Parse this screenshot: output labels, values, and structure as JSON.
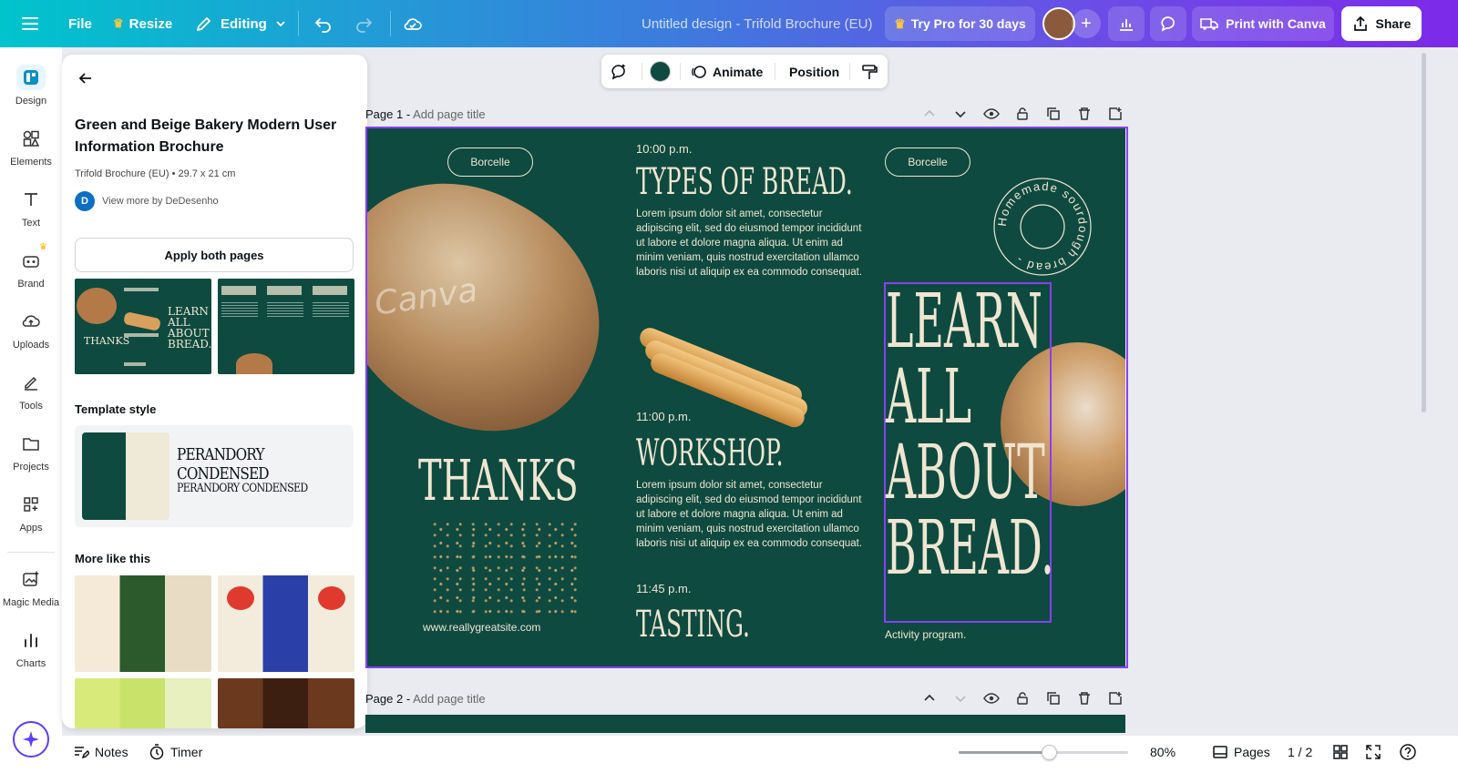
{
  "topbar": {
    "menu_icon": "hamburger-icon",
    "file_label": "File",
    "resize_label": "Resize",
    "editing_label": "Editing",
    "doc_title": "Untitled design - Trifold Brochure (EU)",
    "try_pro_label": "Try Pro for 30 days",
    "print_label": "Print with Canva",
    "share_label": "Share"
  },
  "rail": {
    "items": [
      {
        "label": "Design",
        "icon": "design-icon"
      },
      {
        "label": "Elements",
        "icon": "elements-icon"
      },
      {
        "label": "Text",
        "icon": "text-icon"
      },
      {
        "label": "Brand",
        "icon": "brand-icon"
      },
      {
        "label": "Uploads",
        "icon": "uploads-icon"
      },
      {
        "label": "Tools",
        "icon": "tools-icon"
      },
      {
        "label": "Projects",
        "icon": "projects-icon"
      },
      {
        "label": "Apps",
        "icon": "apps-icon"
      },
      {
        "label": "Magic Media",
        "icon": "magic-media-icon"
      },
      {
        "label": "Charts",
        "icon": "charts-icon"
      }
    ]
  },
  "panel": {
    "title": "Green and Beige Bakery Modern User Information Brochure",
    "meta": "Trifold Brochure (EU) • 29.7 x 21 cm",
    "author_initial": "D",
    "author_link": "View more by DeDesenho",
    "apply_label": "Apply both pages",
    "template_style_title": "Template style",
    "font_primary": "PERANDORY CONDENSED",
    "font_secondary": "PERANDORY CONDENSED",
    "more_title": "More like this",
    "colors": {
      "green": "#0e4a3f",
      "beige": "#efe9d8"
    }
  },
  "context_toolbar": {
    "animate_label": "Animate",
    "position_label": "Position",
    "color_swatch": "#0e4a3f"
  },
  "pages": [
    {
      "label": "Page 1 -",
      "add_title": "Add page title"
    },
    {
      "label": "Page 2 -",
      "add_title": "Add page title"
    }
  ],
  "brochure": {
    "brand_left": "Borcelle",
    "brand_right": "Borcelle",
    "thanks": "THANKS",
    "website": "www.reallygreatsite.com",
    "time1": "10:00 p.m.",
    "heading1": "TYPES OF BREAD.",
    "lorem1": "Lorem ipsum dolor sit amet, consectetur adipiscing elit, sed do eiusmod tempor incididunt ut labore et dolore magna aliqua. Ut enim ad minim veniam, quis nostrud exercitation ullamco laboris nisi ut aliquip ex ea commodo consequat.",
    "time2": "11:00 p.m.",
    "heading2": "WORKSHOP.",
    "lorem2": "Lorem ipsum dolor sit amet, consectetur adipiscing elit, sed do eiusmod tempor incididunt ut labore et dolore magna aliqua. Ut enim ad minim veniam, quis nostrud exercitation ullamco laboris nisi ut aliquip ex ea commodo consequat.",
    "time3": "11:45 p.m.",
    "heading3": "TASTING.",
    "learn_line1": "LEARN",
    "learn_line2": "ALL",
    "learn_line3": "ABOUT",
    "learn_line4": "BREAD.",
    "stamp_text": "Homemade sourdough bread -",
    "activity": "Activity program.",
    "watermark": "Canva"
  },
  "bottombar": {
    "notes_label": "Notes",
    "timer_label": "Timer",
    "zoom": "80%",
    "zoom_fraction": 0.53,
    "pages_label": "Pages",
    "page_count": "1 / 2"
  }
}
